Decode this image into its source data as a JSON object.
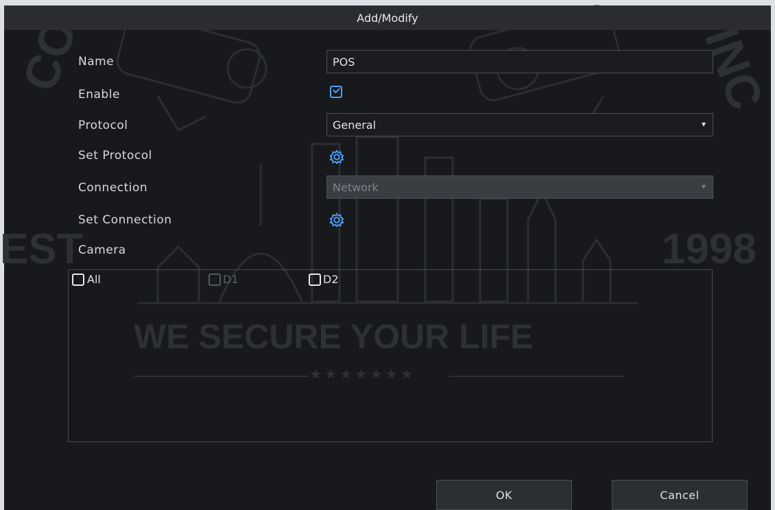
{
  "dialog": {
    "title": "Add/Modify"
  },
  "form": {
    "name_label": "Name",
    "name_value": "POS",
    "enable_label": "Enable",
    "enable_checked": true,
    "protocol_label": "Protocol",
    "protocol_value": "General",
    "set_protocol_label": "Set Protocol",
    "connection_label": "Connection",
    "connection_value": "Network",
    "set_connection_label": "Set Connection",
    "camera_label": "Camera"
  },
  "cameras": {
    "all_label": "All",
    "items": [
      {
        "label": "D1",
        "enabled": false,
        "checked": false
      },
      {
        "label": "D2",
        "enabled": true,
        "checked": false
      }
    ]
  },
  "buttons": {
    "ok": "OK",
    "cancel": "Cancel"
  },
  "watermark": {
    "left_text": "EST",
    "right_text": "1998",
    "slogan": "WE SECURE YOUR LIFE",
    "stars": "★★★★★★★",
    "corner_left": "CO",
    "corner_right": "INC"
  },
  "colors": {
    "accent": "#4ea1ff",
    "background": "#17191c",
    "titlebar": "#2a2c30"
  },
  "icons": {
    "settings": "gear-icon",
    "dropdown": "chevron-down-icon",
    "checkbox": "checkbox-icon"
  }
}
